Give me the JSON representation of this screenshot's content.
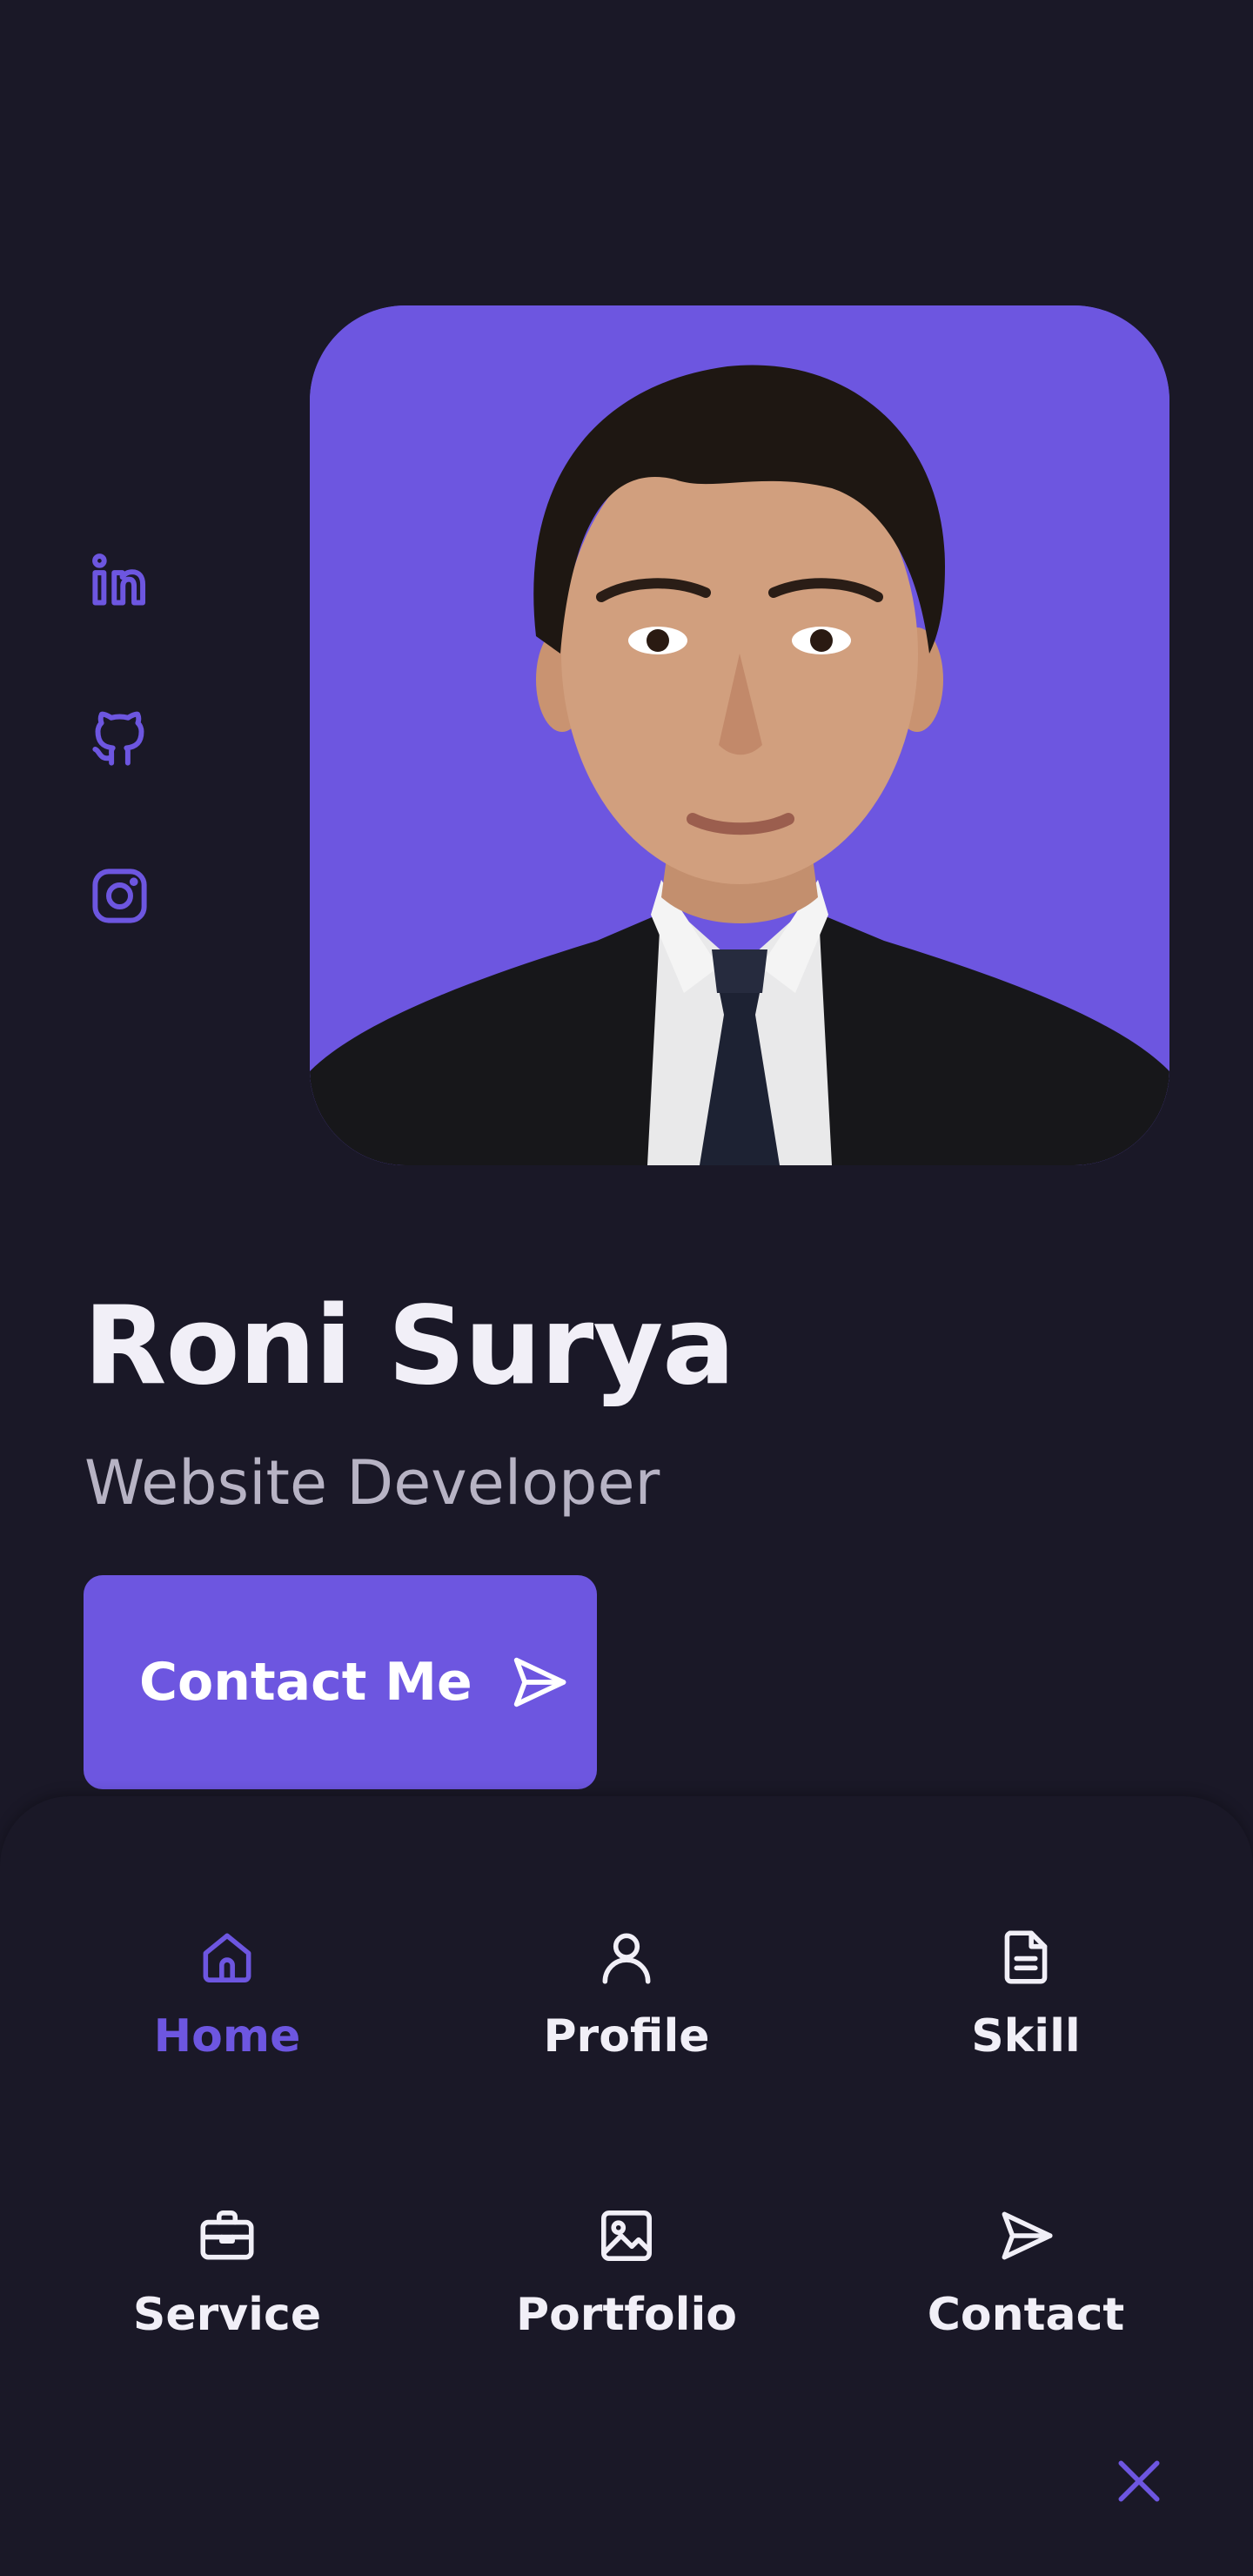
{
  "social": {
    "items": [
      {
        "icon": "linkedin-icon"
      },
      {
        "icon": "github-icon"
      },
      {
        "icon": "instagram-icon"
      }
    ]
  },
  "hero": {
    "name": "Roni Surya",
    "role": "Website Developer",
    "button_label": "Contact Me",
    "button_icon": "send-icon"
  },
  "menu": {
    "items": [
      {
        "label": "Home",
        "icon": "home-icon",
        "active": true
      },
      {
        "label": "Profile",
        "icon": "user-icon",
        "active": false
      },
      {
        "label": "Skill",
        "icon": "file-icon",
        "active": false
      },
      {
        "label": "Service",
        "icon": "briefcase-icon",
        "active": false
      },
      {
        "label": "Portfolio",
        "icon": "image-icon",
        "active": false
      },
      {
        "label": "Contact",
        "icon": "send-icon",
        "active": false
      }
    ],
    "close_icon": "close-icon"
  },
  "colors": {
    "background": "#1a1827",
    "accent": "#6d56e0",
    "text": "#f1eff7",
    "muted": "#b7b3c4"
  }
}
